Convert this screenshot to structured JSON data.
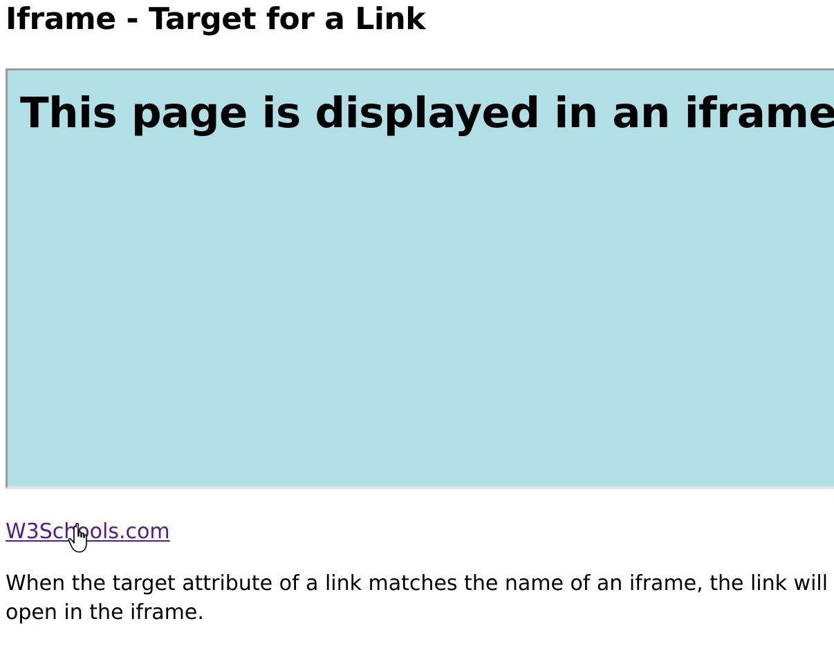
{
  "page": {
    "title": "Iframe - Target for a Link"
  },
  "iframe": {
    "heading": "This page is displayed in an iframe",
    "background_color": "#b0dfe5"
  },
  "link": {
    "label": "W3Schools.com",
    "color": "#551a8b"
  },
  "cursor": {
    "icon": "hand-pointer-icon"
  },
  "description": {
    "text": "When the target attribute of a link matches the name of an iframe, the link will open in the iframe."
  }
}
